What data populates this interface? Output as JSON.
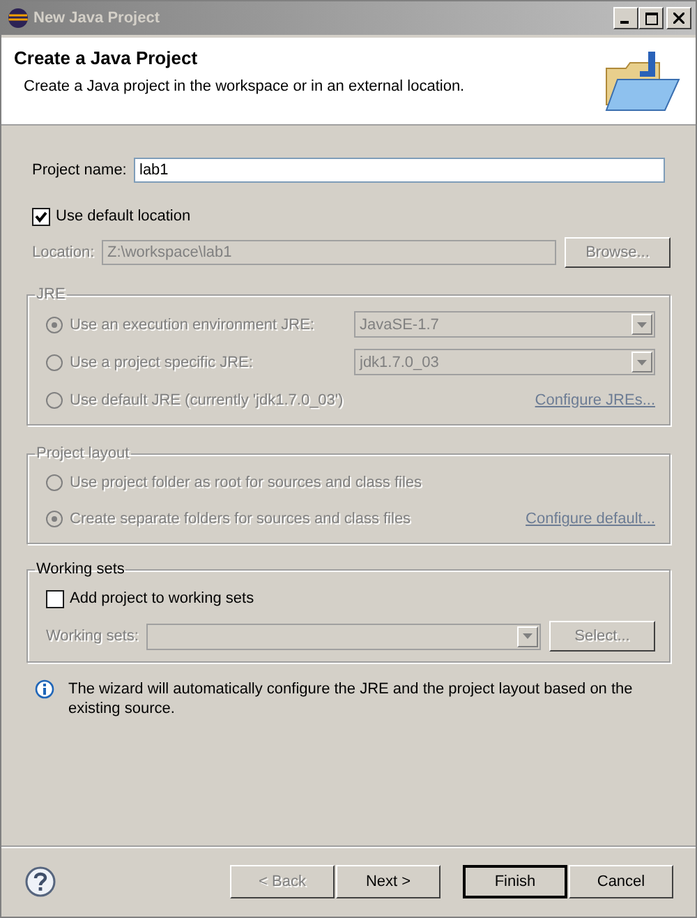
{
  "window": {
    "title": "New Java Project",
    "active": false
  },
  "header": {
    "title": "Create a Java Project",
    "description": "Create a Java project in the workspace or in an external location."
  },
  "project_name": {
    "label": "Project name:",
    "value": "lab1"
  },
  "use_default_location": {
    "label": "Use default location",
    "checked": true
  },
  "location": {
    "label": "Location:",
    "value": "Z:\\workspace\\lab1",
    "disabled": true,
    "button": "Browse..."
  },
  "jre": {
    "title": "JRE",
    "disabled": true,
    "options": [
      {
        "label": "Use an execution environment JRE:",
        "selected": true,
        "kind": "combo",
        "value": "JavaSE-1.7"
      },
      {
        "label": "Use a project specific JRE:",
        "selected": false,
        "kind": "combo",
        "value": "jdk1.7.0_03"
      },
      {
        "label": "Use default JRE (currently 'jdk1.7.0_03')",
        "selected": false,
        "kind": "link",
        "link": "Configure JREs..."
      }
    ]
  },
  "project_layout": {
    "title": "Project layout",
    "disabled": true,
    "options": [
      {
        "label": "Use project folder as root for sources and class files",
        "selected": false,
        "kind": "plain"
      },
      {
        "label": "Create separate folders for sources and class files",
        "selected": true,
        "kind": "link",
        "link": "Configure default..."
      }
    ]
  },
  "working_sets": {
    "title": "Working sets",
    "checkbox": {
      "label": "Add project to working sets",
      "checked": false
    },
    "field_label": "Working sets:",
    "disabled": true,
    "button": "Select..."
  },
  "info": "The wizard will automatically configure the JRE and the project layout based on the existing source.",
  "buttons": [
    {
      "label": "< Back",
      "disabled": true,
      "default": false
    },
    {
      "label": "Next >",
      "disabled": false,
      "default": false
    },
    {
      "label": "Finish",
      "disabled": false,
      "default": true
    },
    {
      "label": "Cancel",
      "disabled": false,
      "default": false
    }
  ]
}
